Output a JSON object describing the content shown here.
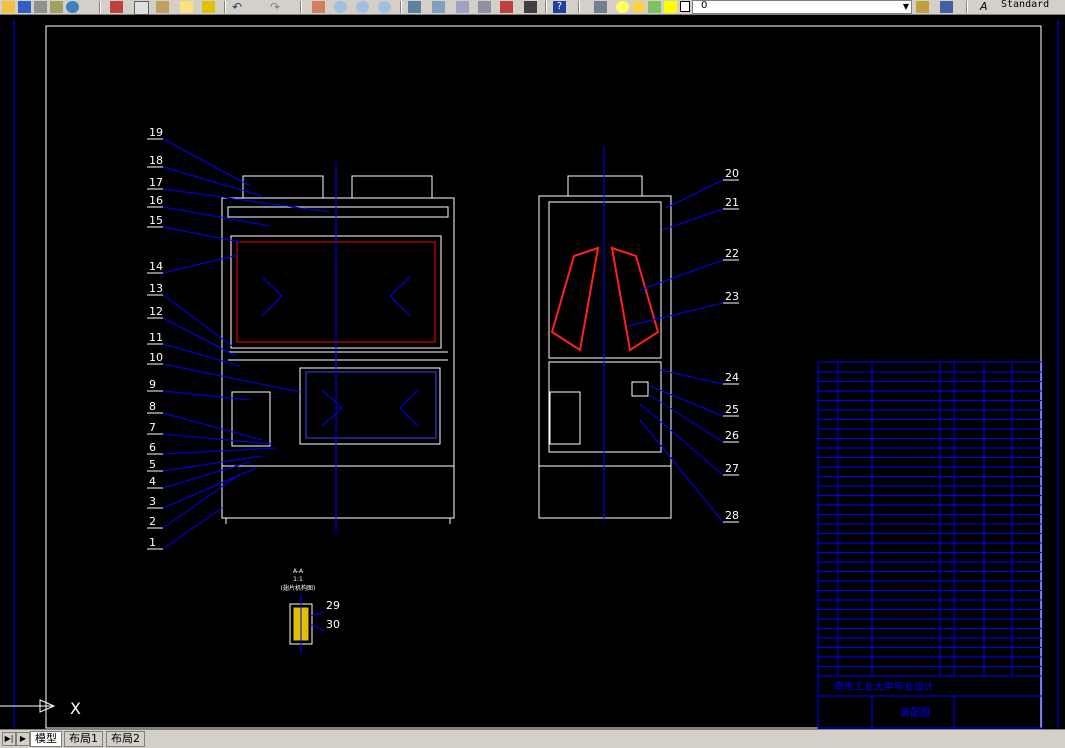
{
  "toolbar": {
    "layer_name": "0",
    "text_style": "Standard",
    "icons": [
      "open-icon",
      "save-icon",
      "print-icon",
      "preview-icon",
      "cut-icon",
      "copy-icon",
      "paste-icon",
      "match-properties-icon",
      "undo-icon",
      "redo-icon",
      "pan-icon",
      "zoom-realtime-icon",
      "zoom-window-icon",
      "zoom-previous-icon",
      "properties-icon",
      "design-center-icon",
      "tool-palettes-icon",
      "sheet-set-icon",
      "markup-icon",
      "quickcalc-icon",
      "help-icon",
      "layer-manager-icon",
      "layer-state-icon",
      "layer-prev-icon",
      "text-style-icon"
    ]
  },
  "drawing": {
    "callouts_left": [
      "19",
      "18",
      "17",
      "16",
      "15",
      "14",
      "13",
      "12",
      "11",
      "10",
      "9",
      "8",
      "7",
      "6",
      "5",
      "4",
      "3",
      "2",
      "1"
    ],
    "callouts_right": [
      "20",
      "21",
      "22",
      "23",
      "24",
      "25",
      "26",
      "27",
      "28"
    ],
    "callouts_section": [
      "29",
      "30"
    ],
    "section_title": "A-A",
    "section_scale": "1:1",
    "section_note": "(翅片机构图)",
    "title_block_school": "南京工业大学毕业设计",
    "title_block_name": "装配图"
  },
  "tabs": [
    {
      "label": "模型",
      "active": true
    },
    {
      "label": "布局1",
      "active": false
    },
    {
      "label": "布局2",
      "active": false
    }
  ],
  "colors": {
    "accent": "#0000ff",
    "background": "#000000",
    "lines": "#ffffff",
    "coil": "#ff0000"
  }
}
